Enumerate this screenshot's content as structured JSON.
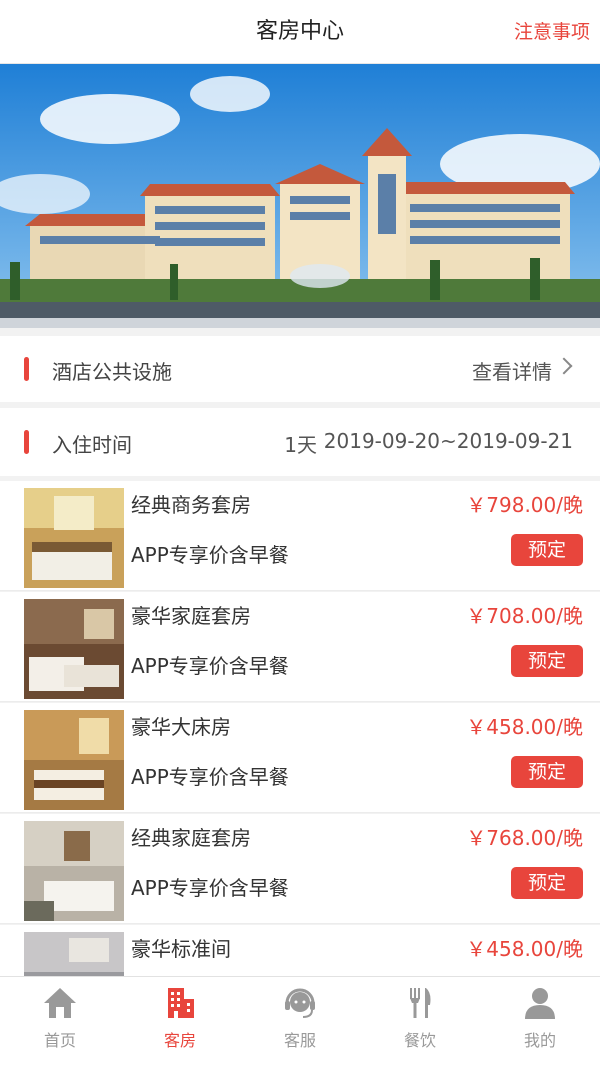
{
  "header": {
    "title": "客房中心",
    "notice_label": "注意事项"
  },
  "facilities": {
    "label": "酒店公共设施",
    "link_label": "查看详情"
  },
  "checkin": {
    "label": "入住时间",
    "days": "1天",
    "range": "2019-09-20~2019-09-21"
  },
  "rooms": [
    {
      "name": "经典商务套房",
      "subtitle": "APP专享价含早餐",
      "price": "￥798.00/晚",
      "book_label": "预定"
    },
    {
      "name": "豪华家庭套房",
      "subtitle": "APP专享价含早餐",
      "price": "￥708.00/晚",
      "book_label": "预定"
    },
    {
      "name": "豪华大床房",
      "subtitle": "APP专享价含早餐",
      "price": "￥458.00/晚",
      "book_label": "预定"
    },
    {
      "name": "经典家庭套房",
      "subtitle": "APP专享价含早餐",
      "price": "￥768.00/晚",
      "book_label": "预定"
    },
    {
      "name": "豪华标准间",
      "subtitle": "",
      "price": "￥458.00/晚",
      "book_label": ""
    }
  ],
  "tabbar": [
    {
      "label": "首页",
      "icon": "home-icon",
      "active": false
    },
    {
      "label": "客房",
      "icon": "hotel-building-icon",
      "active": true
    },
    {
      "label": "客服",
      "icon": "headset-icon",
      "active": false
    },
    {
      "label": "餐饮",
      "icon": "fork-knife-icon",
      "active": false
    },
    {
      "label": "我的",
      "icon": "user-icon",
      "active": false
    }
  ],
  "colors": {
    "accent": "#e8453c",
    "inactive": "#999999",
    "background": "#f2f2f2"
  }
}
